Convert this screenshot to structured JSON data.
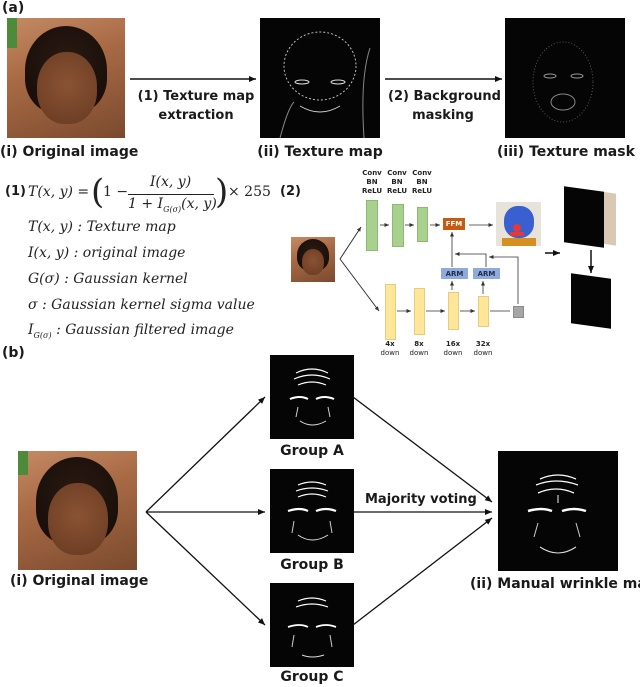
{
  "panel_a": {
    "label": "(a)",
    "captions": {
      "original": "(i) Original image",
      "texture_map": "(ii) Texture map",
      "texture_mask": "(iii) Texture mask"
    },
    "arrows": {
      "step1_line1": "(1) Texture map",
      "step1_line2": "extraction",
      "step2_line1": "(2) Background",
      "step2_line2": "masking"
    },
    "formula": {
      "tag": "(1)",
      "lhs": "T(x, y) = ",
      "open": "(",
      "one_minus": "1 −",
      "numerator": "I(x, y)",
      "denominator": "1 + I",
      "denominator_sub": "G(σ)",
      "denominator_tail": "(x, y)",
      "close": ")",
      "times": "× 255",
      "definitions": [
        "T(x, y) : Texture map",
        "I(x, y) : original image",
        "G(σ) : Gaussian kernel",
        "σ : Gaussian kernel sigma value",
        "I_G(σ) : Gaussian filtered image"
      ],
      "def5_main": "I",
      "def5_sub": "G(σ)",
      "def5_text": " : Gaussian filtered image"
    },
    "network": {
      "tag": "(2)",
      "conv_labels": [
        "Conv",
        "BN",
        "ReLU"
      ],
      "ffm": "FFM",
      "arm": "ARM",
      "down_labels": [
        {
          "scale": "4x",
          "word": "down"
        },
        {
          "scale": "8x",
          "word": "down"
        },
        {
          "scale": "16x",
          "word": "down"
        },
        {
          "scale": "32x",
          "word": "down"
        }
      ],
      "colors": {
        "spatial_path": "#a9d18e",
        "context_path": "#ffe699",
        "ffm": "#c55a11",
        "arm": "#8faadc",
        "pool": "#a6a6a6"
      }
    }
  },
  "panel_b": {
    "label": "(b)",
    "original_caption": "(i) Original image",
    "groups": [
      "Group A",
      "Group B",
      "Group C"
    ],
    "voting_label": "Majority voting",
    "result_caption": "(ii) Manual wrinkle mask"
  }
}
